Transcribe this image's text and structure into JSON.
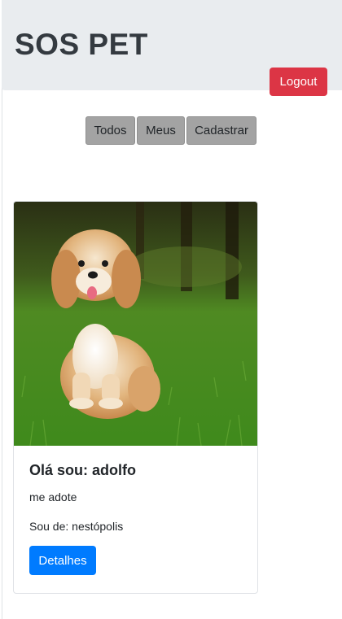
{
  "header": {
    "title": "SOS PET",
    "logout_label": "Logout"
  },
  "nav": {
    "items": [
      {
        "label": "Todos"
      },
      {
        "label": "Meus"
      },
      {
        "label": "Cadastrar"
      }
    ]
  },
  "pets": [
    {
      "image_alt": "dog",
      "title": "Olá sou: adolfo",
      "description": "me adote",
      "location": "Sou de: nestópolis",
      "details_label": "Detalhes"
    }
  ],
  "colors": {
    "header_bg": "#e9ecef",
    "logout": "#dc3545",
    "nav_button": "#a3a3a3",
    "primary": "#007bff"
  }
}
